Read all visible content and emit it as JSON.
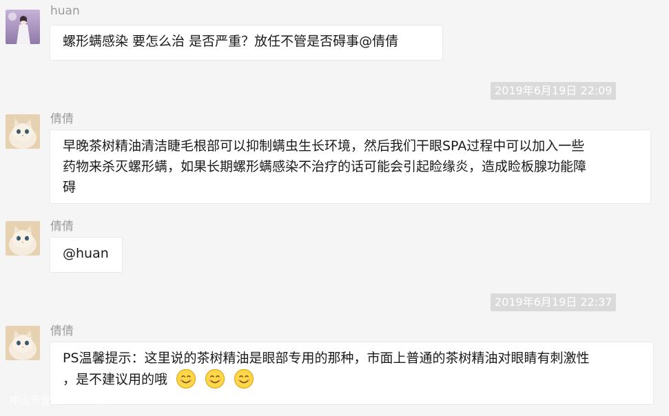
{
  "messages": [
    {
      "sender": "huan",
      "text": "螺形螨感染 要怎么治 是否严重？放任不管是否碍事@倩倩"
    },
    {
      "sender": "倩倩",
      "lines": [
        "早晚茶树精油清洁睫毛根部可以抑制螨虫生长环境，然后我们干眼SPA过程中可以加入一些",
        "药物来杀灭螺形螨，如果长期螺形螨感染不治疗的话可能会引起睑缘炎，造成睑板腺功能障",
        "碍"
      ]
    },
    {
      "sender": "倩倩",
      "text": "@huan"
    },
    {
      "sender": "倩倩",
      "lines": [
        "PS温馨提示：这里说的茶树精油是眼部专用的那种，市面上普通的茶树精油对眼睛有刺激性",
        "，是不建议用的哦"
      ],
      "emojis": [
        "smile-emoji",
        "smile-emoji",
        "smile-emoji"
      ]
    }
  ],
  "timestamps": [
    "2019年6月19日 22:09",
    "2019年6月19日 22:37"
  ],
  "watermark": "中山市爱尔眼科医院",
  "colors": {
    "background": "#f5f5f5",
    "bubble": "#ffffff",
    "timestamp_bg": "#dadada",
    "sender_name": "#9b9b9b"
  }
}
